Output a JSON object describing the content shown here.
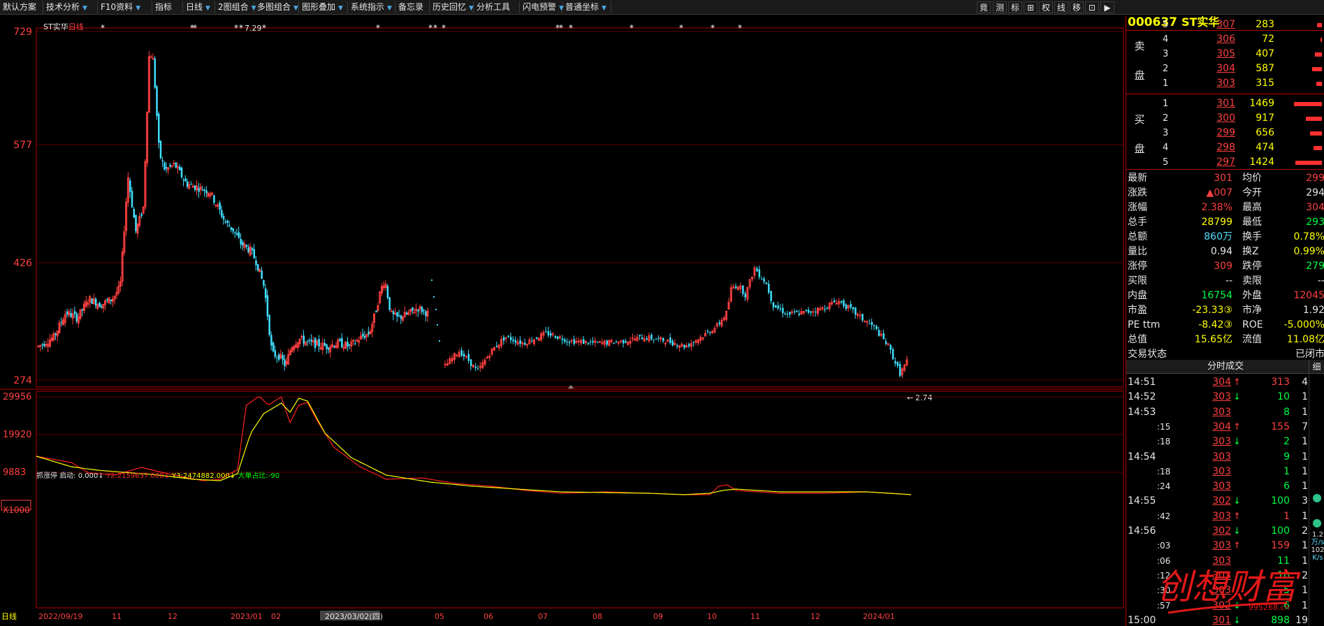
{
  "toolbar": {
    "items": [
      {
        "label": "默认方案"
      },
      {
        "label": "技术分析"
      },
      {
        "label": "F10资料"
      },
      {
        "label": "指标"
      },
      {
        "label": "日线"
      },
      {
        "label": "2图组合"
      },
      {
        "label": "多图组合"
      },
      {
        "label": "图形叠加"
      },
      {
        "label": "系统指示"
      },
      {
        "label": "备忘录"
      },
      {
        "label": "历史回忆"
      },
      {
        "label": "分析工具"
      },
      {
        "label": "闪电预警"
      },
      {
        "label": "普通坐标"
      }
    ],
    "right_buttons": [
      "竟",
      "测",
      "标",
      "⊞",
      "权",
      "线",
      "移",
      "⊡",
      "▶"
    ]
  },
  "main_chart": {
    "stock_name": "ST实华",
    "period": "日线",
    "y_ticks": [
      "729",
      "577",
      "426",
      "274"
    ],
    "high_label": "7.29",
    "low_label": "2.74",
    "x_ticks": [
      "2022/09/19",
      "11",
      "12",
      "2023/01",
      "02",
      "2023/03/02(四)",
      "05",
      "06",
      "07",
      "08",
      "09",
      "10",
      "11",
      "12",
      "2024/01"
    ],
    "bottom_left_label": "日线"
  },
  "indicator": {
    "legend": {
      "name": "抓涨停",
      "start_label": "启动:",
      "start_value": "0.000↓",
      "y2_label": "Y2:",
      "y2_value": "2159637.000↓",
      "y3_label": "Y3:",
      "y3_value": "2474882.000↓",
      "big_label": "大单占比:",
      "big_value": "-90"
    },
    "y_ticks": [
      "29956",
      "19920",
      "9883"
    ],
    "multiplier": "X1000"
  },
  "quote": {
    "code": "000637",
    "name": "ST实华",
    "sell_label_1": "卖",
    "sell_label_2": "盘",
    "buy_label_1": "买",
    "buy_label_2": "盘",
    "asks": [
      {
        "level": "5",
        "price": "307",
        "volume": "283",
        "bar": 0.17
      },
      {
        "level": "4",
        "price": "306",
        "volume": "72",
        "bar": 0.05
      },
      {
        "level": "3",
        "price": "305",
        "volume": "407",
        "bar": 0.25
      },
      {
        "level": "2",
        "price": "304",
        "volume": "587",
        "bar": 0.35
      },
      {
        "level": "1",
        "price": "303",
        "volume": "315",
        "bar": 0.19
      }
    ],
    "bids": [
      {
        "level": "1",
        "price": "301",
        "volume": "1469",
        "bar": 1.0
      },
      {
        "level": "2",
        "price": "300",
        "volume": "917",
        "bar": 0.58
      },
      {
        "level": "3",
        "price": "299",
        "volume": "656",
        "bar": 0.42
      },
      {
        "level": "4",
        "price": "298",
        "volume": "474",
        "bar": 0.3
      },
      {
        "level": "5",
        "price": "297",
        "volume": "1424",
        "bar": 0.96
      }
    ],
    "fields": [
      {
        "l1": "最新",
        "v1": "301",
        "c1": "red",
        "l2": "均价",
        "v2": "299",
        "c2": "red"
      },
      {
        "l1": "涨跌",
        "v1": "▲007",
        "c1": "red",
        "l2": "今开",
        "v2": "294",
        "c2": "wht"
      },
      {
        "l1": "涨幅",
        "v1": "2.38%",
        "c1": "red",
        "l2": "最高",
        "v2": "304",
        "c2": "red"
      },
      {
        "l1": "总手",
        "v1": "28799",
        "c1": "yel",
        "l2": "最低",
        "v2": "293",
        "c2": "grn"
      },
      {
        "l1": "总额",
        "v1": "860万",
        "c1": "cyn",
        "l2": "换手",
        "v2": "0.78%",
        "c2": "yel"
      },
      {
        "l1": "量比",
        "v1": "0.94",
        "c1": "wht",
        "l2": "换Z",
        "v2": "0.99%",
        "c2": "yel"
      },
      {
        "l1": "涨停",
        "v1": "309",
        "c1": "red",
        "l2": "跌停",
        "v2": "279",
        "c2": "grn"
      },
      {
        "l1": "买限",
        "v1": "--",
        "c1": "wht",
        "l2": "卖限",
        "v2": "--",
        "c2": "wht"
      },
      {
        "l1": "内盘",
        "v1": "16754",
        "c1": "grn",
        "l2": "外盘",
        "v2": "12045",
        "c2": "red"
      },
      {
        "l1": "市盈",
        "v1": "-23.33③",
        "c1": "yel",
        "l2": "市净",
        "v2": "1.92",
        "c2": "wht"
      },
      {
        "l1": "PE ttm",
        "v1": "-8.42③",
        "c1": "yel",
        "l2": "ROE",
        "v2": "-5.000%",
        "c2": "yel"
      },
      {
        "l1": "总值",
        "v1": "15.65亿",
        "c1": "yel",
        "l2": "流值",
        "v2": "11.08亿",
        "c2": "yel"
      },
      {
        "l1": "交易状态",
        "v1": "",
        "c1": "wht",
        "l2": "",
        "v2": "已闭市",
        "c2": "wht"
      }
    ],
    "ticks_header": "分时成交",
    "ticks_detail": "细",
    "ticks": [
      {
        "time": "14:51",
        "sub": false,
        "price": "304",
        "dir": "up",
        "vol": "313",
        "vc": "red",
        "cnt": "4"
      },
      {
        "time": "14:52",
        "sub": false,
        "price": "303",
        "dir": "down",
        "vol": "10",
        "vc": "grn",
        "cnt": "1"
      },
      {
        "time": "14:53",
        "sub": false,
        "price": "303",
        "dir": "",
        "vol": "8",
        "vc": "grn",
        "cnt": "1"
      },
      {
        "time": ":15",
        "sub": true,
        "price": "304",
        "dir": "up",
        "vol": "155",
        "vc": "red",
        "cnt": "7"
      },
      {
        "time": ":18",
        "sub": true,
        "price": "303",
        "dir": "down",
        "vol": "2",
        "vc": "grn",
        "cnt": "1"
      },
      {
        "time": "14:54",
        "sub": false,
        "price": "303",
        "dir": "",
        "vol": "9",
        "vc": "grn",
        "cnt": "1"
      },
      {
        "time": ":18",
        "sub": true,
        "price": "303",
        "dir": "",
        "vol": "1",
        "vc": "grn",
        "cnt": "1"
      },
      {
        "time": ":24",
        "sub": true,
        "price": "303",
        "dir": "",
        "vol": "6",
        "vc": "grn",
        "cnt": "1"
      },
      {
        "time": "14:55",
        "sub": false,
        "price": "302",
        "dir": "down",
        "vol": "100",
        "vc": "grn",
        "cnt": "3"
      },
      {
        "time": ":42",
        "sub": true,
        "price": "303",
        "dir": "up",
        "vol": "1",
        "vc": "red",
        "cnt": "1"
      },
      {
        "time": "14:56",
        "sub": false,
        "price": "302",
        "dir": "down",
        "vol": "100",
        "vc": "grn",
        "cnt": "2"
      },
      {
        "time": ":03",
        "sub": true,
        "price": "303",
        "dir": "up",
        "vol": "159",
        "vc": "red",
        "cnt": "1"
      },
      {
        "time": ":06",
        "sub": true,
        "price": "303",
        "dir": "",
        "vol": "11",
        "vc": "grn",
        "cnt": "1"
      },
      {
        "time": ":12",
        "sub": true,
        "price": "303",
        "dir": "",
        "vol": "10",
        "vc": "grn",
        "cnt": "2"
      },
      {
        "time": ":30",
        "sub": true,
        "price": "303",
        "dir": "",
        "vol": "5",
        "vc": "grn",
        "cnt": "1"
      },
      {
        "time": ":57",
        "sub": true,
        "price": "302",
        "dir": "down",
        "vol": "6",
        "vc": "grn",
        "cnt": "1"
      },
      {
        "time": "15:00",
        "sub": false,
        "price": "301",
        "dir": "down",
        "vol": "898",
        "vc": "grn",
        "cnt": "19"
      }
    ],
    "scroll_labels": [
      "1.2",
      "万/s",
      "102",
      "K/s"
    ]
  },
  "watermark": {
    "text": "创想财富",
    "url": "995268.cn"
  },
  "colors": {
    "up": "#ff4040",
    "down": "#40e0ff",
    "line_red": "#ff2020",
    "line_yellow": "#ffff00",
    "frame": "#b40000"
  }
}
